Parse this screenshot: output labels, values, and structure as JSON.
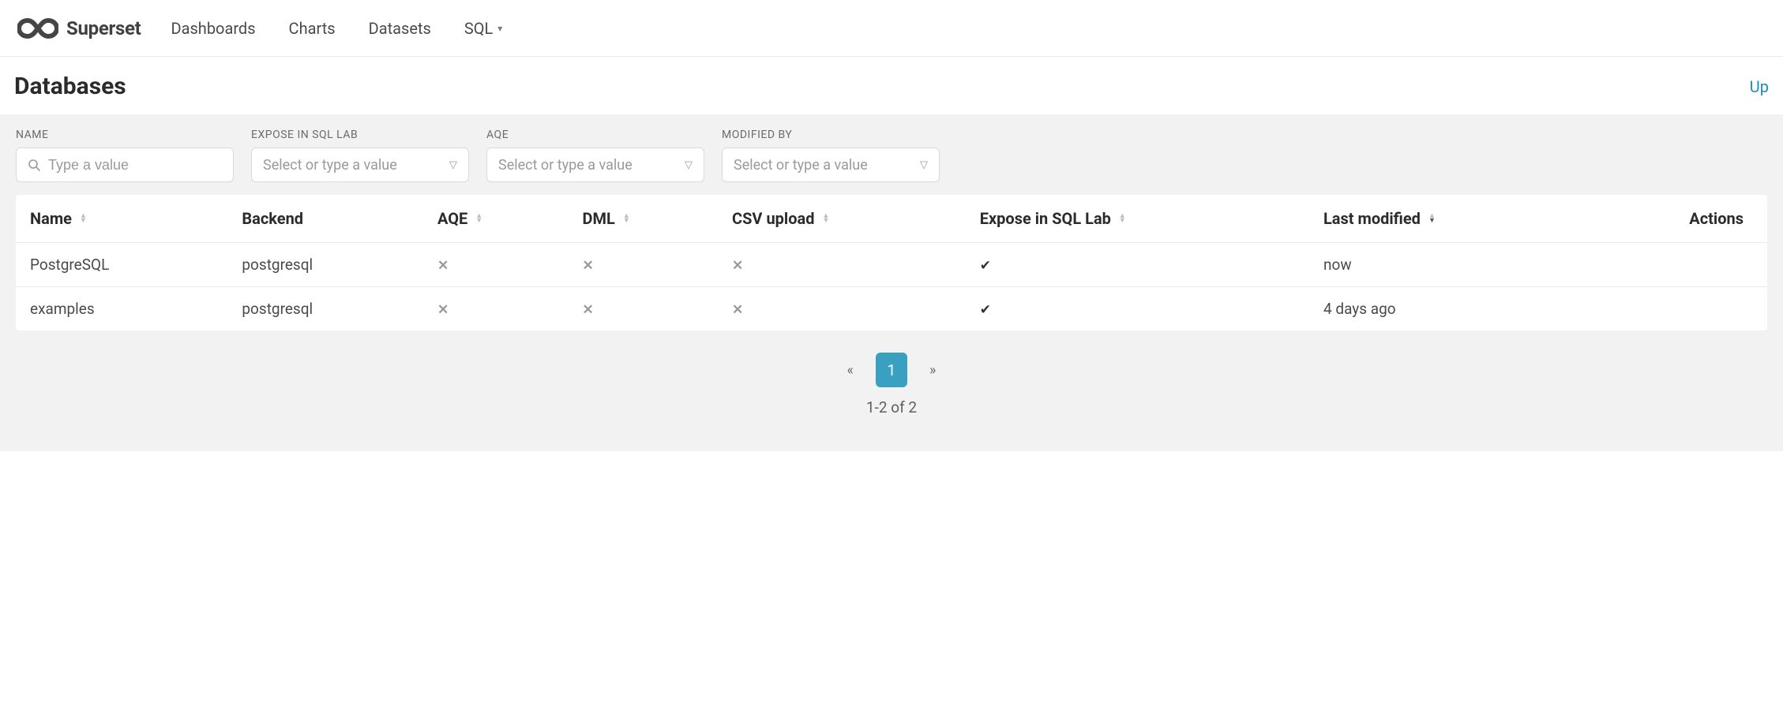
{
  "app": {
    "logo_text": "Superset"
  },
  "nav": {
    "dashboards": "Dashboards",
    "charts": "Charts",
    "datasets": "Datasets",
    "sql": "SQL"
  },
  "page": {
    "title": "Databases",
    "upload": "Up"
  },
  "filters": {
    "name": {
      "label": "NAME",
      "placeholder": "Type a value"
    },
    "expose": {
      "label": "EXPOSE IN SQL LAB",
      "placeholder": "Select or type a value"
    },
    "aqe": {
      "label": "AQE",
      "placeholder": "Select or type a value"
    },
    "modified_by": {
      "label": "MODIFIED BY",
      "placeholder": "Select or type a value"
    }
  },
  "table": {
    "headers": {
      "name": "Name",
      "backend": "Backend",
      "aqe": "AQE",
      "dml": "DML",
      "csv_upload": "CSV upload",
      "expose": "Expose in SQL Lab",
      "last_modified": "Last modified",
      "actions": "Actions"
    },
    "rows": [
      {
        "name": "PostgreSQL",
        "backend": "postgresql",
        "aqe": false,
        "dml": false,
        "csv_upload": false,
        "expose": true,
        "last_modified": "now"
      },
      {
        "name": "examples",
        "backend": "postgresql",
        "aqe": false,
        "dml": false,
        "csv_upload": false,
        "expose": true,
        "last_modified": "4 days ago"
      }
    ]
  },
  "pagination": {
    "current_page": "1",
    "summary": "1-2 of 2"
  },
  "icons": {
    "true_glyph": "✔",
    "false_glyph": "✕"
  }
}
